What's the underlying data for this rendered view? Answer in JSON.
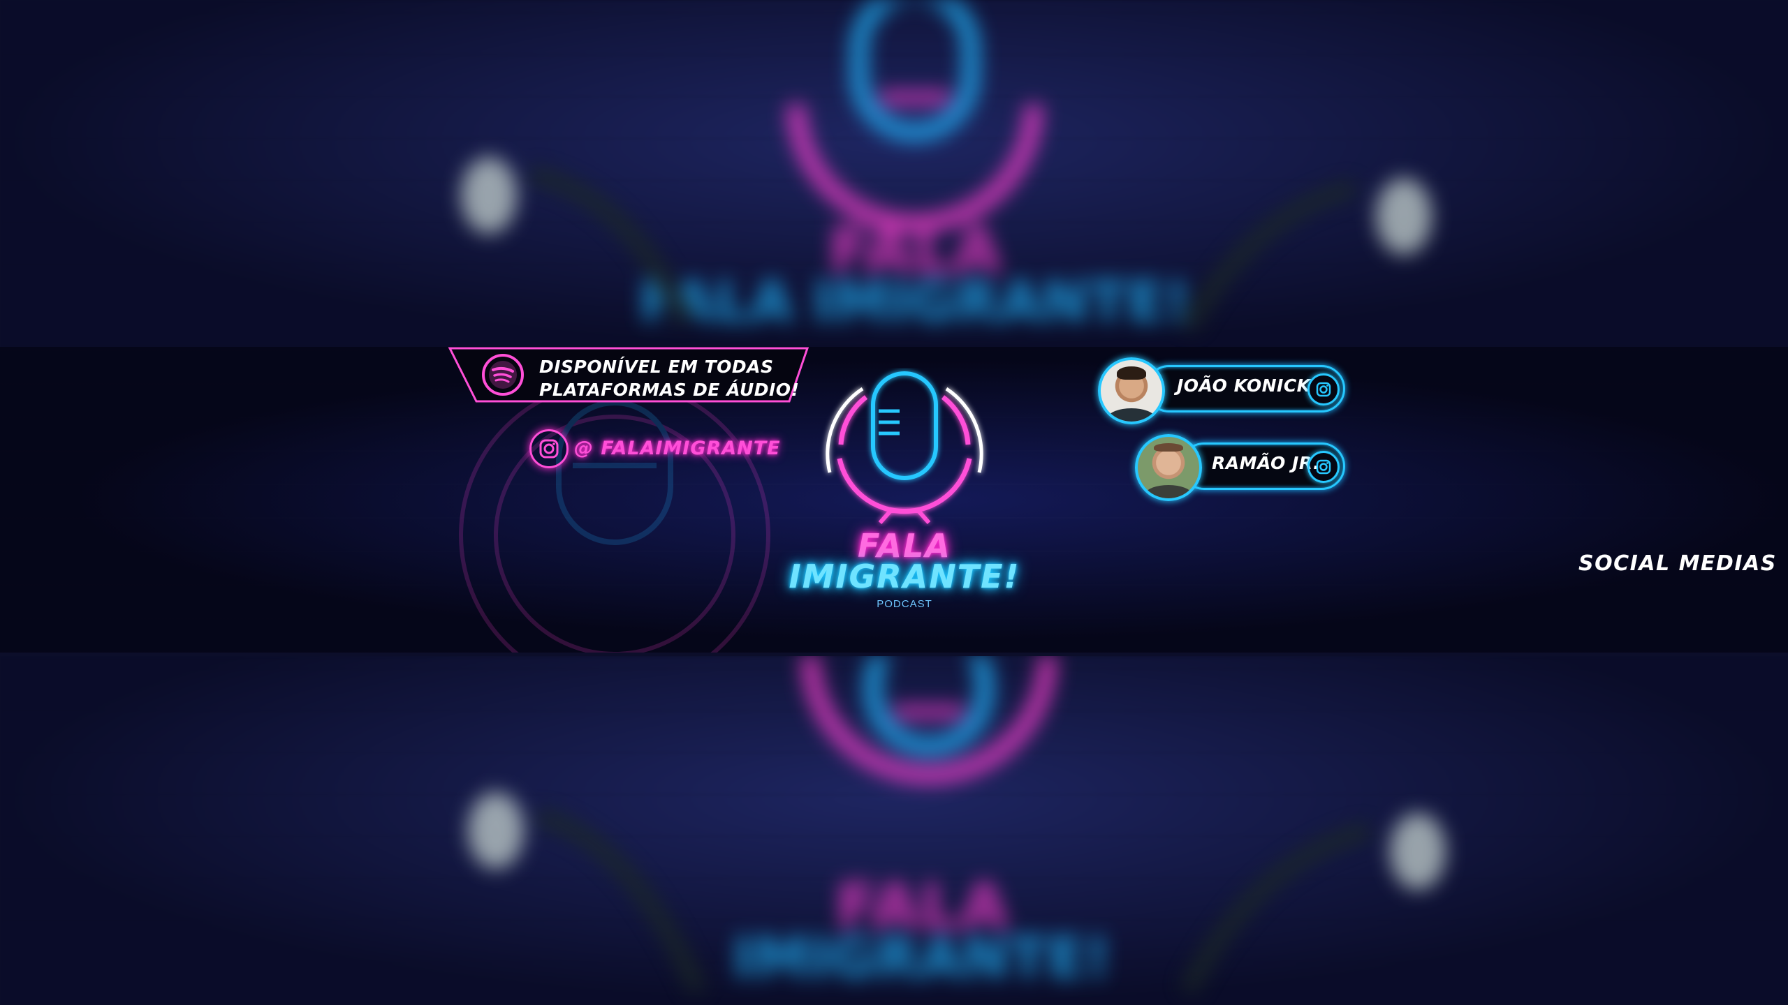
{
  "banner": {
    "availability_line1": "DISPONÍVEL EM TODAS",
    "availability_line2": "PLATAFORMAS DE ÁUDIO!",
    "instagram_handle": "@ FALAIMIGRANTE",
    "title_line1": "FALA",
    "title_line2": "IMIGRANTE!",
    "subtitle": "PODCAST",
    "social_label": "SOCIAL MEDIAS"
  },
  "hosts": [
    {
      "name": "JOÃO KONICK"
    },
    {
      "name": "RAMÃO JR."
    }
  ],
  "blurred_title_top": "FALA IMIGRANTE!",
  "colors": {
    "neon_pink": "#ff4fd8",
    "neon_blue": "#27c8ff",
    "background": "#0c0e2a"
  },
  "icons": [
    "spotify-icon",
    "instagram-icon",
    "microphone-icon"
  ]
}
